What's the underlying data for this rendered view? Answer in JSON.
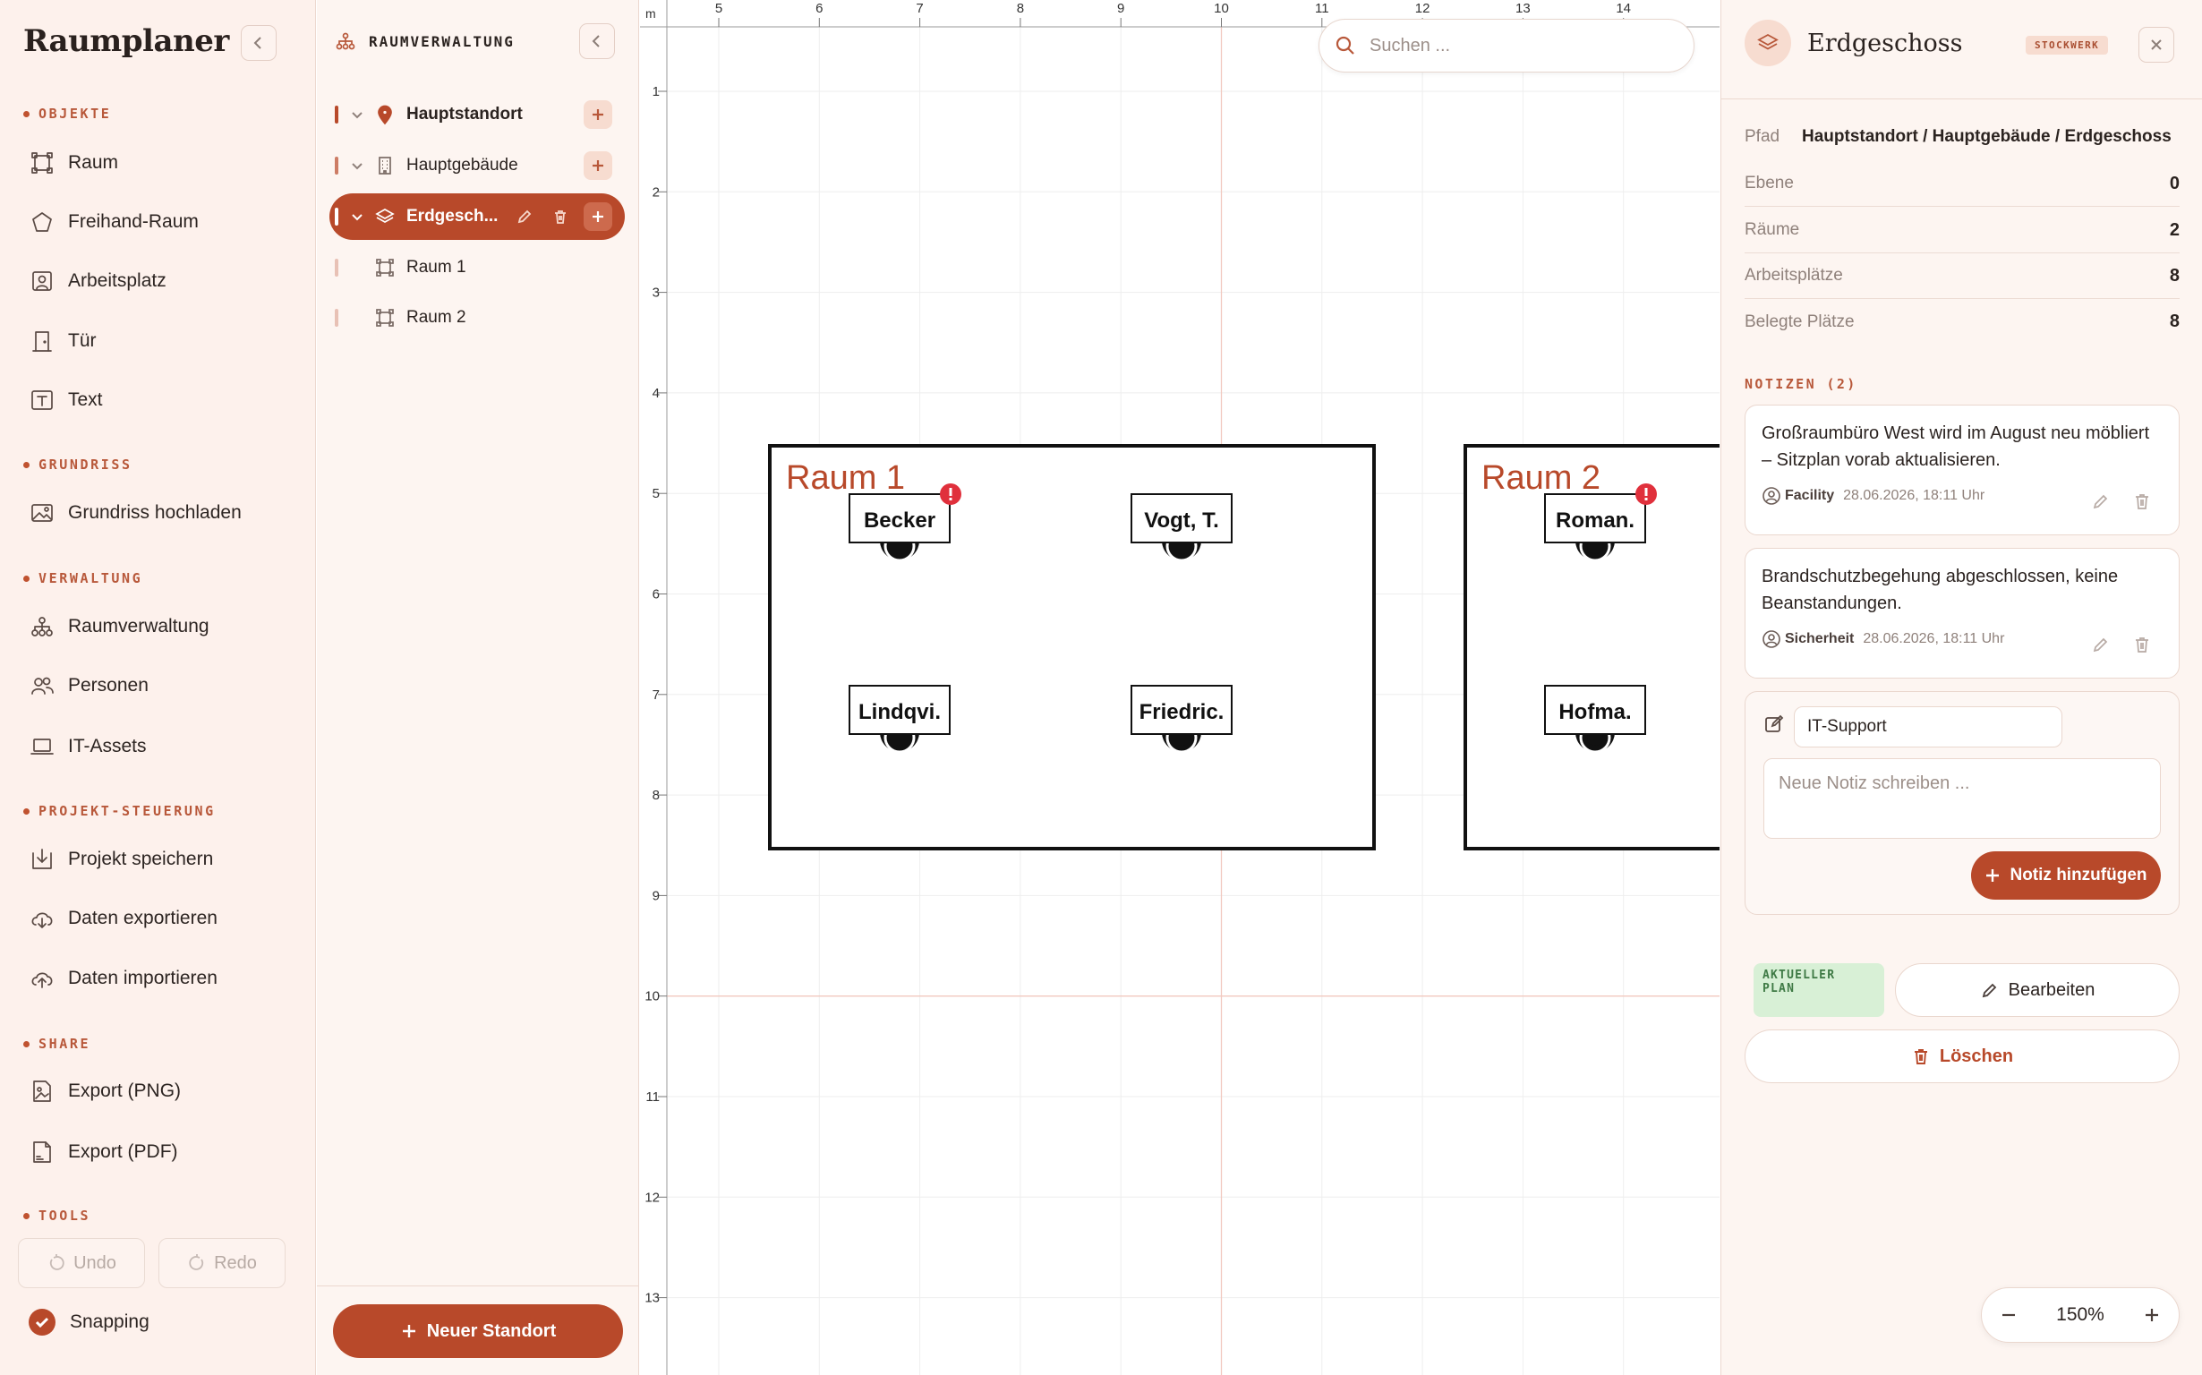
{
  "app": {
    "title": "Raumplaner"
  },
  "sidebar": {
    "sections": [
      {
        "title": "OBJEKTE",
        "items": [
          {
            "label": "Raum",
            "icon": "room-icon"
          },
          {
            "label": "Freihand-Raum",
            "icon": "pentagon-icon"
          },
          {
            "label": "Arbeitsplatz",
            "icon": "workplace-icon"
          },
          {
            "label": "Tür",
            "icon": "door-icon"
          },
          {
            "label": "Text",
            "icon": "text-icon"
          }
        ]
      },
      {
        "title": "GRUNDRISS",
        "items": [
          {
            "label": "Grundriss hochladen",
            "icon": "image-icon"
          }
        ]
      },
      {
        "title": "VERWALTUNG",
        "items": [
          {
            "label": "Raumverwaltung",
            "icon": "hierarchy-icon"
          },
          {
            "label": "Personen",
            "icon": "people-icon"
          },
          {
            "label": "IT-Assets",
            "icon": "laptop-icon"
          }
        ]
      },
      {
        "title": "PROJEKT-STEUERUNG",
        "items": [
          {
            "label": "Projekt speichern",
            "icon": "save-icon"
          },
          {
            "label": "Daten exportieren",
            "icon": "cloud-download-icon"
          },
          {
            "label": "Daten importieren",
            "icon": "cloud-upload-icon"
          }
        ]
      },
      {
        "title": "SHARE",
        "items": [
          {
            "label": "Export (PNG)",
            "icon": "png-file-icon"
          },
          {
            "label": "Export (PDF)",
            "icon": "pdf-file-icon"
          }
        ]
      },
      {
        "title": "TOOLS",
        "items": []
      }
    ],
    "tools": {
      "undo": "Undo",
      "redo": "Redo",
      "snapping": "Snapping",
      "snapping_on": true
    }
  },
  "tree": {
    "title": "RAUMVERWALTUNG",
    "items": [
      {
        "label": "Hauptstandort",
        "icon": "location-pin-icon"
      },
      {
        "label": "Hauptgebäude",
        "icon": "building-icon"
      },
      {
        "label": "Erdgesch...",
        "icon": "layers-icon",
        "selected": true
      },
      {
        "label": "Raum 1",
        "icon": "room-icon"
      },
      {
        "label": "Raum 2",
        "icon": "room-icon"
      }
    ],
    "new_button": "Neuer Standort"
  },
  "canvas": {
    "unit": "m",
    "search_placeholder": "Suchen ...",
    "x_ticks": [
      "5",
      "6",
      "7",
      "8",
      "9",
      "10",
      "11",
      "12",
      "13",
      "14"
    ],
    "y_ticks": [
      "1",
      "2",
      "3",
      "4",
      "5",
      "6",
      "7",
      "8",
      "9",
      "10",
      "11",
      "12",
      "13"
    ],
    "rooms": [
      {
        "name": "Raum 1",
        "desks": [
          "Becker",
          "Vogt, T.",
          "Lindqvi.",
          "Friedric."
        ],
        "warning": true
      },
      {
        "name": "Raum 2",
        "desks": [
          "Roman.",
          "Hofma."
        ],
        "warning": true
      }
    ],
    "accent_color": "#b8492a",
    "warning_color": "#e0303c"
  },
  "details": {
    "title": "Erdgeschoss",
    "type_badge": "STOCKWERK",
    "path_label": "Pfad",
    "path_value": "Hauptstandort / Hauptgebäude / Erdgeschoss",
    "rows": [
      {
        "label": "Ebene",
        "value": "0"
      },
      {
        "label": "Räume",
        "value": "2"
      },
      {
        "label": "Arbeitsplätze",
        "value": "8"
      },
      {
        "label": "Belegte Plätze",
        "value": "8"
      }
    ],
    "notes_title": "NOTIZEN (2)",
    "notes": [
      {
        "text": "Großraumbüro West wird im August neu möbliert – Sitzplan vorab aktualisieren.",
        "author": "Facility",
        "date": "28.06.2026, 18:11 Uhr"
      },
      {
        "text": "Brandschutzbegehung abgeschlossen, keine Beanstandungen.",
        "author": "Sicherheit",
        "date": "28.06.2026, 18:11 Uhr"
      }
    ],
    "compose": {
      "author_value": "IT-Support",
      "placeholder": "Neue Notiz schreiben ...",
      "add_label": "Notiz hinzufügen"
    },
    "current_plan": "AKTUELLER PLAN",
    "edit_label": "Bearbeiten",
    "delete_label": "Löschen",
    "zoom": "150%"
  }
}
